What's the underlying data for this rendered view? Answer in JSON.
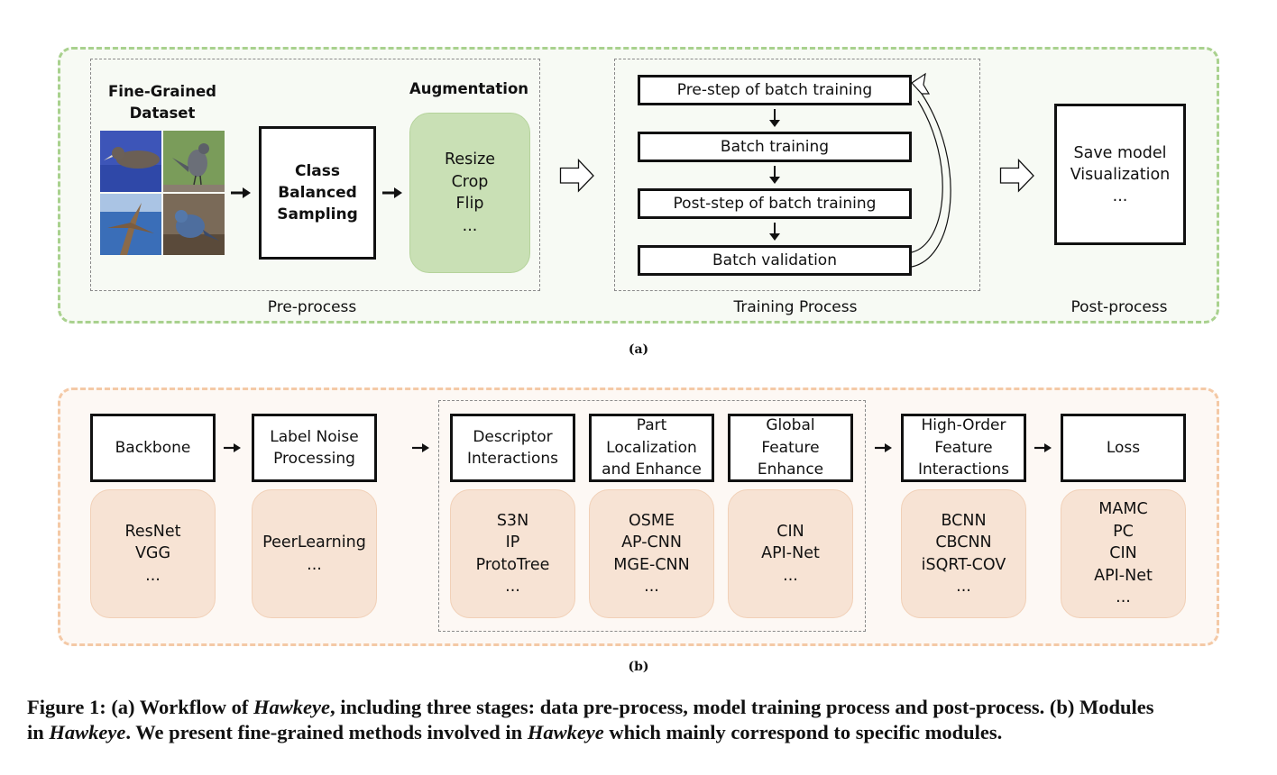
{
  "figure_a": {
    "preprocess": {
      "dataset_title": [
        "Fine-Grained",
        "Dataset"
      ],
      "dataset_images": [
        "albatross-on-water",
        "gray-catbird",
        "albatross-in-flight",
        "blue-bird-on-ground"
      ],
      "sampling_box": [
        "Class",
        "Balanced",
        "Sampling"
      ],
      "augmentation_title": "Augmentation",
      "augmentation_items": [
        "Resize",
        "Crop",
        "Flip",
        "..."
      ],
      "stage_label": "Pre-process"
    },
    "training": {
      "steps": [
        "Pre-step of batch training",
        "Batch training",
        "Post-step of batch training",
        "Batch validation"
      ],
      "stage_label": "Training Process"
    },
    "postprocess": {
      "items": [
        "Save model",
        "Visualization",
        "..."
      ],
      "stage_label": "Post-process"
    },
    "sublabel": "(a)"
  },
  "figure_b": {
    "modules": [
      {
        "title": [
          "Backbone"
        ],
        "methods": [
          "ResNet",
          "VGG",
          "..."
        ]
      },
      {
        "title": [
          "Label Noise",
          "Processing"
        ],
        "methods": [
          "PeerLearning",
          "..."
        ]
      },
      {
        "title": [
          "Descriptor",
          "Interactions"
        ],
        "methods": [
          "S3N",
          "IP",
          "ProtoTree",
          "..."
        ]
      },
      {
        "title": [
          "Part",
          "Localization",
          "and Enhance"
        ],
        "methods": [
          "OSME",
          "AP-CNN",
          "MGE-CNN",
          "..."
        ]
      },
      {
        "title": [
          "Global",
          "Feature",
          "Enhance"
        ],
        "methods": [
          "CIN",
          "API-Net",
          "..."
        ]
      },
      {
        "title": [
          "High-Order",
          "Feature",
          "Interactions"
        ],
        "methods": [
          "BCNN",
          "CBCNN",
          "iSQRT-COV",
          "..."
        ]
      },
      {
        "title": [
          "Loss"
        ],
        "methods": [
          "MAMC",
          "PC",
          "CIN",
          "API-Net",
          "..."
        ]
      }
    ],
    "sublabel": "(b)"
  },
  "caption": {
    "line1_parts": [
      "Figure 1: (a) Workflow of ",
      "Hawkeye",
      ", including three stages: data pre-process, model training process and post-process. (b) Modules"
    ],
    "line2_parts": [
      "in ",
      "Hawkeye",
      ". We present fine-grained methods involved in ",
      "Hawkeye",
      " which mainly correspond to specific modules."
    ]
  },
  "colors": {
    "green_border": "#a9d18e",
    "green_fill": "#c9e0b5",
    "orange_border": "#f4c9a6",
    "orange_fill": "#f7e3d4"
  }
}
